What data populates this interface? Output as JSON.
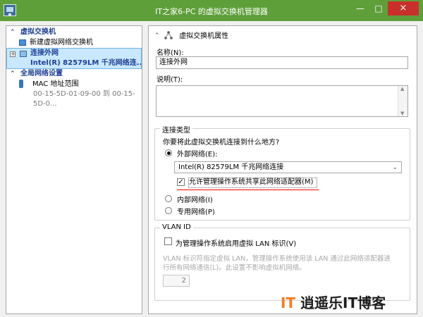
{
  "window": {
    "title": "IT之家6-PC 的虚拟交换机管理器",
    "minimize": "—",
    "maximize": "□",
    "close": "×"
  },
  "left": {
    "group_virtual": "虚拟交换机",
    "new_switch": "新建虚拟网络交换机",
    "selected_main": "连接外网",
    "selected_sub": "Intel(R) 82579LM 千兆网络连...",
    "group_global": "全局网络设置",
    "mac_label": "MAC 地址范围",
    "mac_range": "00-15-5D-01-09-00 到 00-15-5D-0..."
  },
  "right": {
    "properties_title": "虚拟交换机属性",
    "name_label": "名称(N):",
    "name_value": "连接外网",
    "desc_label": "说明(T):",
    "conn_group": "连接类型",
    "conn_question": "你要将此虚拟交换机连接到什么地方?",
    "external": "外部网络(E):",
    "adapter": "Intel(R) 82579LM 千兆网络连接",
    "allow_share": "允许管理操作系统共享此网络适配器(M)",
    "internal": "内部网络(I)",
    "private": "专用网络(P)",
    "vlan_group": "VLAN ID",
    "vlan_enable": "为管理操作系统启用虚拟 LAN 标识(V)",
    "vlan_desc": "VLAN 标识符指定虚拟 LAN，管理操作系统使用该 LAN 通过此网络适配器进行所有网络通信(L)。此设置不影响虚拟机网络。",
    "vlan_value": "2"
  },
  "watermark": {
    "logo": "IT",
    "text": "逍遥乐IT博客"
  }
}
